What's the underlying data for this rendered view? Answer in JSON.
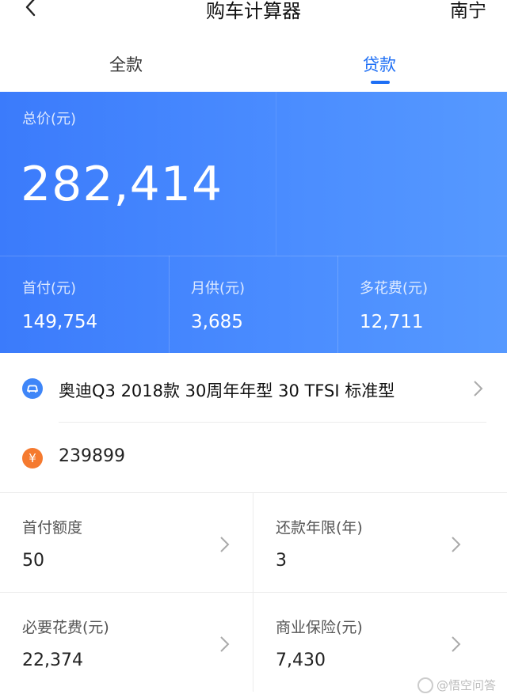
{
  "header": {
    "title": "购车计算器",
    "city": "南宁"
  },
  "tabs": [
    {
      "label": "全款",
      "active": false
    },
    {
      "label": "贷款",
      "active": true
    }
  ],
  "summary": {
    "total_label": "总价(元)",
    "total_value": "282,414",
    "stats": [
      {
        "label": "首付(元)",
        "value": "149,754"
      },
      {
        "label": "月供(元)",
        "value": "3,685"
      },
      {
        "label": "多花费(元)",
        "value": "12,711"
      }
    ]
  },
  "car": {
    "name": "奥迪Q3 2018款 30周年年型 30 TFSI 标准型",
    "icon": "car-icon"
  },
  "price": {
    "icon_glyph": "¥",
    "value": "239899"
  },
  "options": [
    {
      "label": "首付额度",
      "value": "50"
    },
    {
      "label": "还款年限(年)",
      "value": "3"
    },
    {
      "label": "必要花费(元)",
      "value": "22,374"
    },
    {
      "label": "商业保险(元)",
      "value": "7,430"
    }
  ],
  "watermark": "@悟空问答",
  "colors": {
    "accent": "#1e6ff5",
    "banner_start": "#3b7bfb",
    "banner_end": "#5699ff",
    "price_icon": "#f57a2f"
  }
}
